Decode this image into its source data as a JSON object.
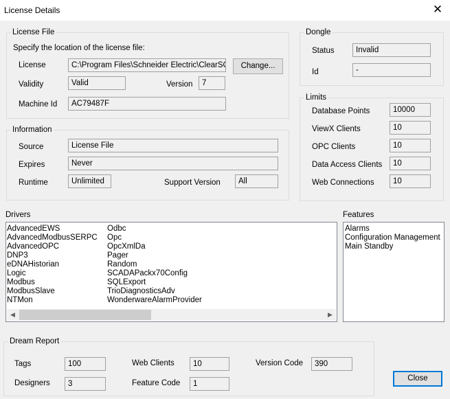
{
  "window": {
    "title": "License Details"
  },
  "license_file": {
    "group_label": "License File",
    "instruction": "Specify the location of the license file:",
    "license_label": "License",
    "license_value": "C:\\Program Files\\Schneider Electric\\ClearSCA",
    "change_button": "Change...",
    "validity_label": "Validity",
    "validity_value": "Valid",
    "version_label": "Version",
    "version_value": "7",
    "machine_id_label": "Machine Id",
    "machine_id_value": "AC79487F"
  },
  "information": {
    "group_label": "Information",
    "source_label": "Source",
    "source_value": "License File",
    "expires_label": "Expires",
    "expires_value": "Never",
    "runtime_label": "Runtime",
    "runtime_value": "Unlimited",
    "support_version_label": "Support Version",
    "support_version_value": "All"
  },
  "dongle": {
    "group_label": "Dongle",
    "status_label": "Status",
    "status_value": "Invalid",
    "id_label": "Id",
    "id_value": "-"
  },
  "limits": {
    "group_label": "Limits",
    "rows": [
      {
        "label": "Database Points",
        "value": "10000"
      },
      {
        "label": "ViewX Clients",
        "value": "10"
      },
      {
        "label": "OPC Clients",
        "value": "10"
      },
      {
        "label": "Data Access Clients",
        "value": "10"
      },
      {
        "label": "Web Connections",
        "value": "10"
      }
    ]
  },
  "drivers": {
    "label": "Drivers",
    "col1": [
      "AdvancedEWS",
      "AdvancedModbusSERPC",
      "AdvancedOPC",
      "DNP3",
      "eDNAHistorian",
      "Logic",
      "Modbus",
      "ModbusSlave",
      "NTMon"
    ],
    "col2": [
      "Odbc",
      "Opc",
      "OpcXmlDa",
      "Pager",
      "Random",
      "SCADAPackx70Config",
      "SQLExport",
      "TrioDiagnosticsAdv",
      "WonderwareAlarmProvider"
    ]
  },
  "features": {
    "label": "Features",
    "items": [
      "Alarms",
      "Configuration Management",
      "Main Standby"
    ]
  },
  "dream_report": {
    "group_label": "Dream Report",
    "tags_label": "Tags",
    "tags_value": "100",
    "web_clients_label": "Web Clients",
    "web_clients_value": "10",
    "version_code_label": "Version Code",
    "version_code_value": "390",
    "designers_label": "Designers",
    "designers_value": "3",
    "feature_code_label": "Feature Code",
    "feature_code_value": "1"
  },
  "buttons": {
    "close": "Close"
  }
}
